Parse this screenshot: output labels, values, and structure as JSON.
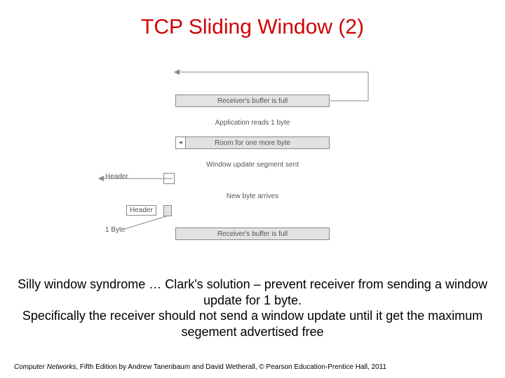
{
  "title": "TCP Sliding Window (2)",
  "diagram": {
    "bar1": "Receiver's buffer is full",
    "cap1": "Application reads 1 byte",
    "bar2": "Room for one more byte",
    "cap2": "Window update segment sent",
    "cap3": "New byte arrives",
    "bar3": "Receiver's buffer is full",
    "header_label": "Header",
    "byte_label": "1 Byte"
  },
  "body_line1": "Silly window syndrome … Clark's solution – prevent receiver from sending a window update for 1 byte.",
  "body_line2": "Specifically the receiver should not send a window update until it get the maximum segement advertised free",
  "footer_italic": "Computer Networks",
  "footer_rest": ", Fifth Edition by Andrew Tanenbaum and David Wetherall, © Pearson Education-Prentice Hall, 2011"
}
